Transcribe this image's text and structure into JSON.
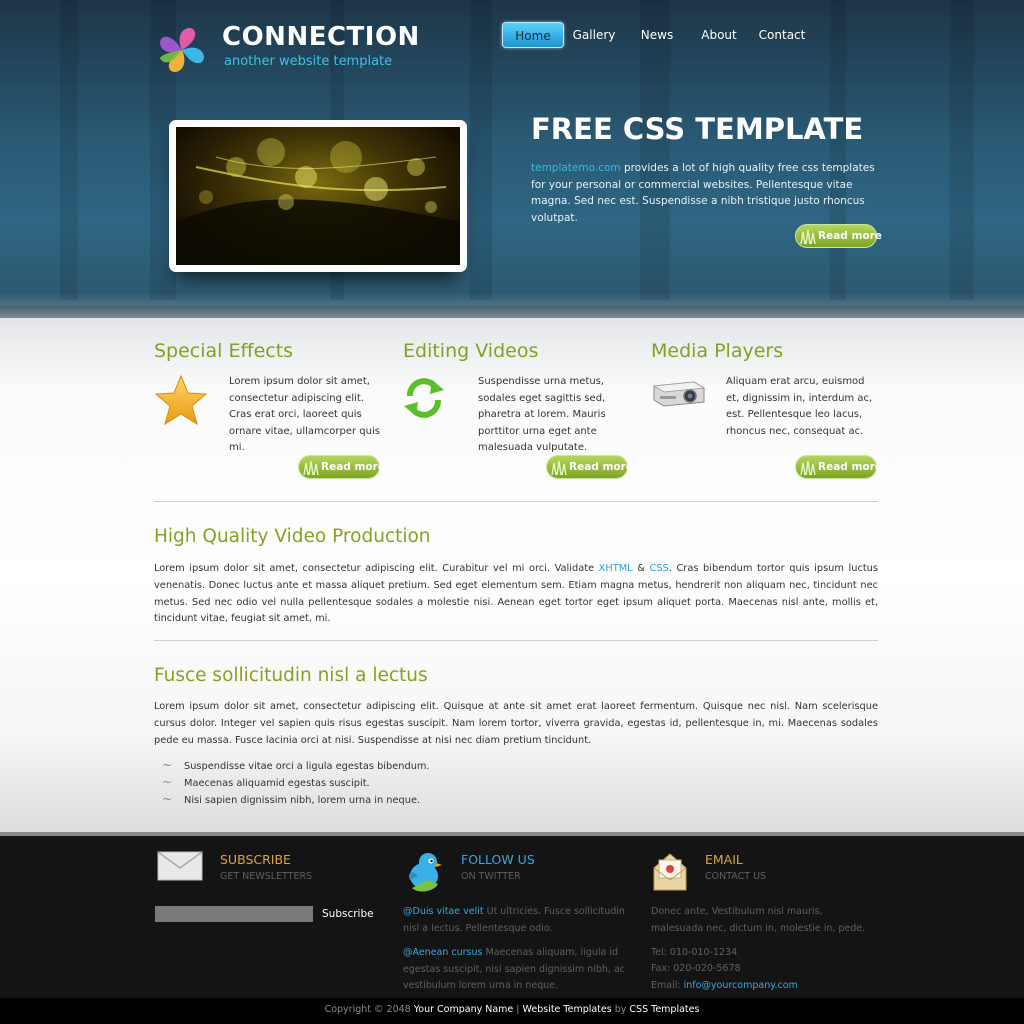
{
  "logo": {
    "title": "CONNECTION",
    "subtitle": "another website template"
  },
  "nav": {
    "items": [
      {
        "label": "Home",
        "active": true
      },
      {
        "label": "Gallery"
      },
      {
        "label": "News"
      },
      {
        "label": "About"
      },
      {
        "label": "Contact"
      }
    ]
  },
  "hero": {
    "title": "FREE CSS TEMPLATE",
    "link_text": "templatemo.com",
    "text": " provides a lot of high quality free css templates for your personal or commercial websites. Pellentesque vitae magna. Sed nec est. Suspendisse a nibh tristique justo rhoncus volutpat.",
    "read_more": "Read more"
  },
  "features": [
    {
      "title": "Special Effects",
      "icon": "star-icon",
      "text": "Lorem ipsum dolor sit amet, consectetur adipiscing elit. Cras erat orci, laoreet quis ornare vitae, ullamcorper quis mi.",
      "read_more": "Read more"
    },
    {
      "title": "Editing Videos",
      "icon": "refresh-arrows-icon",
      "text": "Suspendisse urna metus, sodales eget sagittis sed, pharetra at lorem. Mauris porttitor urna eget ante malesuada vulputate.",
      "read_more": "Read more"
    },
    {
      "title": "Media Players",
      "icon": "projector-icon",
      "text": "Aliquam erat arcu, euismod et, dignissim in, interdum ac, est. Pellentesque leo lacus, rhoncus nec, consequat ac.",
      "read_more": "Read more"
    }
  ],
  "section1": {
    "title": "High Quality Video Production",
    "text_a": "Lorem ipsum dolor sit amet, consectetur adipiscing elit. Curabitur vel mi orci. Validate ",
    "link_xhtml": "XHTML",
    "amp": " & ",
    "link_css": "CSS",
    "text_b": ". Cras bibendum tortor quis ipsum luctus venenatis. Donec luctus ante et massa aliquet pretium. Sed eget elementum sem. Etiam magna metus, hendrerit non aliquam nec, tincidunt nec metus. Sed nec odio vel nulla pellentesque sodales a molestie nisi. Aenean eget tortor eget ipsum aliquet porta. Maecenas nisl ante, mollis et, tincidunt vitae, feugiat sit amet, mi."
  },
  "section2": {
    "title": "Fusce sollicitudin nisl a lectus",
    "text": "Lorem ipsum dolor sit amet, consectetur adipiscing elit. Quisque at ante sit amet erat laoreet fermentum. Quisque nec nisl. Nam scelerisque cursus dolor. Integer vel sapien quis risus egestas suscipit. Nam lorem tortor, viverra gravida, egestas id, pellentesque in, mi. Maecenas sodales pede eu massa. Fusce lacinia orci at nisi. Suspendisse at nisi nec diam pretium tincidunt.",
    "bullets": [
      "Suspendisse vitae orci a ligula egestas bibendum.",
      "Maecenas aliquamid egestas suscipit.",
      "Nisi sapien dignissim nibh, lorem urna in neque."
    ]
  },
  "footer": {
    "subscribe": {
      "title": "SUBSCRIBE",
      "subtitle": "GET NEWSLETTERS",
      "button": "Subscribe",
      "input_placeholder": ""
    },
    "twitter": {
      "title": "FOLLOW US",
      "subtitle": "ON TWITTER",
      "tweets": [
        {
          "handle": "@Duis vitae velit",
          "text": " Ut ultricies. Fusce sollicitudin nisl a lectus. Pellentesque odio."
        },
        {
          "handle": "@Aenean cursus",
          "text": " Maecenas aliquam, ligula id egestas suscipit, nisi sapien dignissim nibh, ac vestibulum lorem urna in neque."
        }
      ]
    },
    "email": {
      "title": "EMAIL",
      "subtitle": "CONTACT US",
      "text": "Donec ante, Vestibulum nisl mauris, malesuada nec, dictum in, molestie in, pede.",
      "tel": "Tel: 010-010-1234",
      "fax": "Fax: 020-020-5678",
      "email_label": "Email: ",
      "email_value": "info@yourcompany.com"
    }
  },
  "copyright": {
    "prefix": "Copyright © 2048 ",
    "company": "Your Company Name",
    "sep": " | ",
    "templates": "Website Templates",
    "by": " by ",
    "css": "CSS Templates"
  },
  "colors": {
    "accent_green": "#82a226",
    "accent_blue": "#3cb7ea",
    "footer_bg": "#141414",
    "subscribe_title": "#d9a53a",
    "twitter_title": "#3aa6de",
    "email_title": "#d9a53a"
  }
}
